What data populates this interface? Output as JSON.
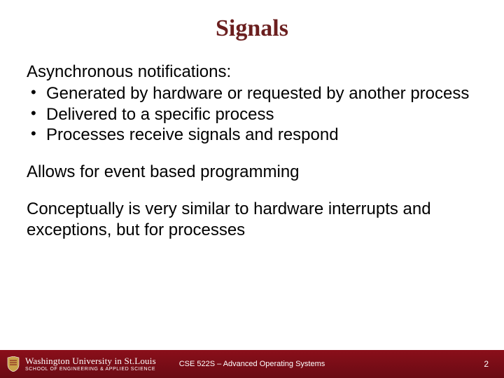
{
  "title": "Signals",
  "body": {
    "lead": "Asynchronous notifications:",
    "bullets": [
      "Generated by hardware or requested by another process",
      "Delivered to a specific process",
      "Processes receive signals and respond"
    ],
    "para1": "Allows for event based programming",
    "para2": "Conceptually is very similar to hardware interrupts and exceptions, but for processes"
  },
  "footer": {
    "university": "Washington University in St.Louis",
    "school": "SCHOOL OF ENGINEERING & APPLIED SCIENCE",
    "course": "CSE 522S – Advanced Operating Systems",
    "page": "2"
  },
  "colors": {
    "title": "#6b1f1f",
    "footer_bg": "#7a0c16",
    "footer_text": "#ffffff"
  }
}
